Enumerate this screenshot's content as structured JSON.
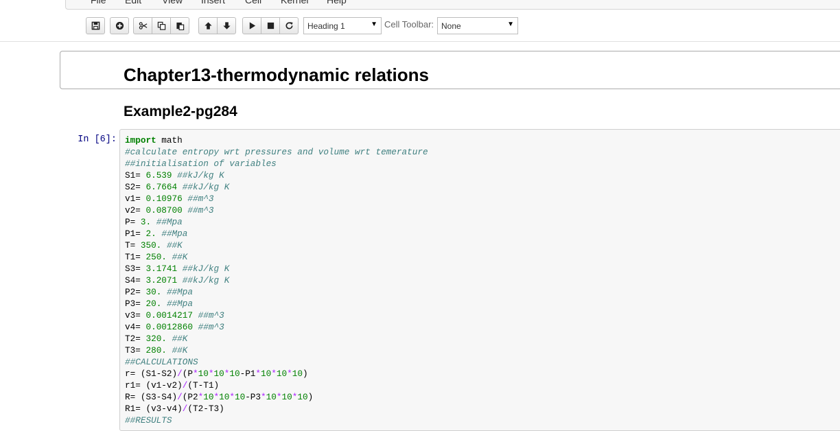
{
  "menubar": {
    "items": [
      "File",
      "Edit",
      "View",
      "Insert",
      "Cell",
      "Kernel",
      "Help"
    ]
  },
  "toolbar": {
    "buttons": [
      {
        "name": "save-button",
        "icon": "floppy-disk-icon"
      },
      {
        "name": "insert-cell-button",
        "icon": "plus-circle-icon"
      },
      {
        "name": "cut-button",
        "icon": "scissors-icon"
      },
      {
        "name": "copy-button",
        "icon": "copy-icon"
      },
      {
        "name": "paste-button",
        "icon": "paste-icon"
      },
      {
        "name": "move-up-button",
        "icon": "arrow-up-icon"
      },
      {
        "name": "move-down-button",
        "icon": "arrow-down-icon"
      },
      {
        "name": "run-button",
        "icon": "play-icon"
      },
      {
        "name": "stop-button",
        "icon": "stop-icon"
      },
      {
        "name": "restart-button",
        "icon": "refresh-icon"
      }
    ],
    "cell_type": "Heading 1",
    "cell_toolbar_label": "Cell Toolbar:",
    "cell_toolbar_value": "None"
  },
  "notebook": {
    "heading1": "Chapter13-thermodynamic relations",
    "heading2": "Example2-pg284",
    "prompt": "In [6]:",
    "code_lines": [
      "import math",
      "#calculate entropy wrt pressures and volume wrt temerature",
      "##initialisation of variables",
      "S1= 6.539 ##kJ/kg K",
      "S2= 6.7664 ##kJ/kg K",
      "v1= 0.10976 ##m^3",
      "v2= 0.08700 ##m^3",
      "P= 3. ##Mpa",
      "P1= 2. ##Mpa",
      "T= 350. ##K",
      "T1= 250. ##K",
      "S3= 3.1741 ##kJ/kg K",
      "S4= 3.2071 ##kJ/kg K",
      "P2= 30. ##Mpa",
      "P3= 20. ##Mpa",
      "v3= 0.0014217 ##m^3",
      "v4= 0.0012860 ##m^3",
      "T2= 320. ##K",
      "T3= 280. ##K",
      "##CALCULATIONS",
      "r= (S1-S2)/(P*10*10*10-P1*10*10*10)",
      "r1= (v1-v2)/(T-T1)",
      "R= (S3-S4)/(P2*10*10*10-P3*10*10*10)",
      "R1= (v3-v4)/(T2-T3)",
      "##RESULTS"
    ]
  },
  "colors": {
    "keyword": "#008000",
    "comment": "#408080",
    "number": "#008000",
    "operator": "#aa22ff",
    "prompt": "#000080"
  }
}
